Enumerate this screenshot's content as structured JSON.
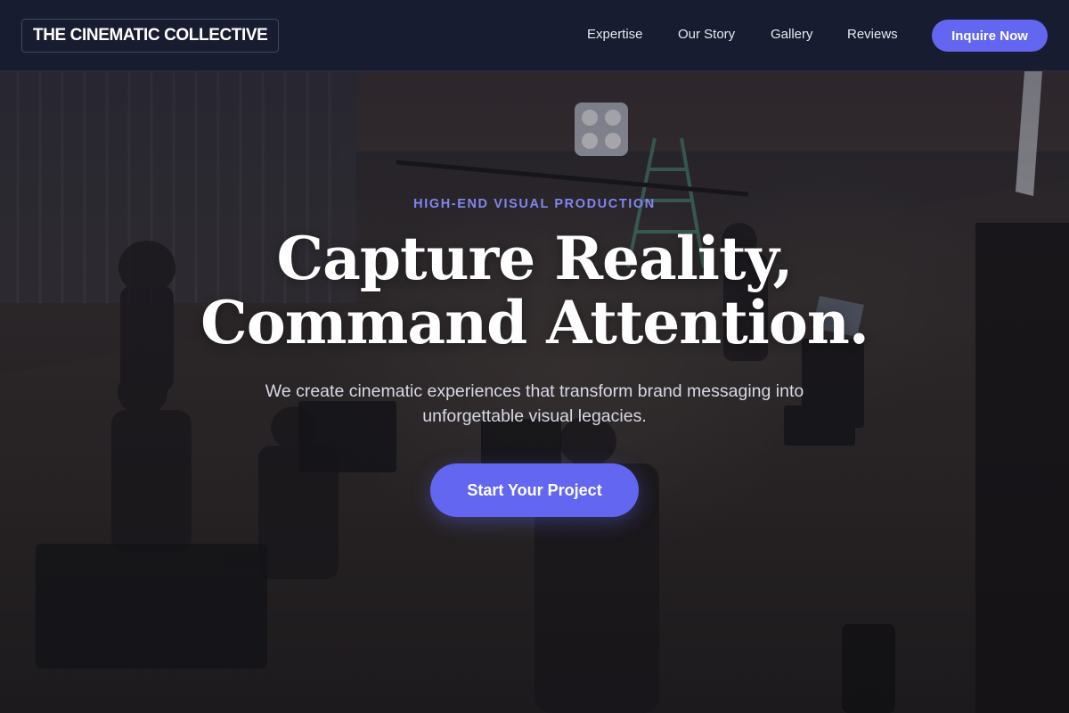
{
  "navbar": {
    "logo_text": "THE CINEMATIC COLLECTIVE",
    "links": [
      {
        "label": "Expertise"
      },
      {
        "label": "Our Story"
      },
      {
        "label": "Gallery"
      },
      {
        "label": "Reviews"
      }
    ],
    "cta_label": "Inquire Now"
  },
  "hero": {
    "eyebrow": "HIGH-END VISUAL PRODUCTION",
    "headline_line1": "Capture Reality,",
    "headline_line2": "Command Attention.",
    "subtitle": "We create cinematic experiences that transform brand messaging into unforgettable visual legacies.",
    "cta_label": "Start Your Project",
    "background_image": "film-set-crew-photo"
  },
  "colors": {
    "accent": "#6366f1",
    "eyebrow": "#8286ef",
    "nav_bg": "#181c30",
    "text": "#ffffff"
  }
}
